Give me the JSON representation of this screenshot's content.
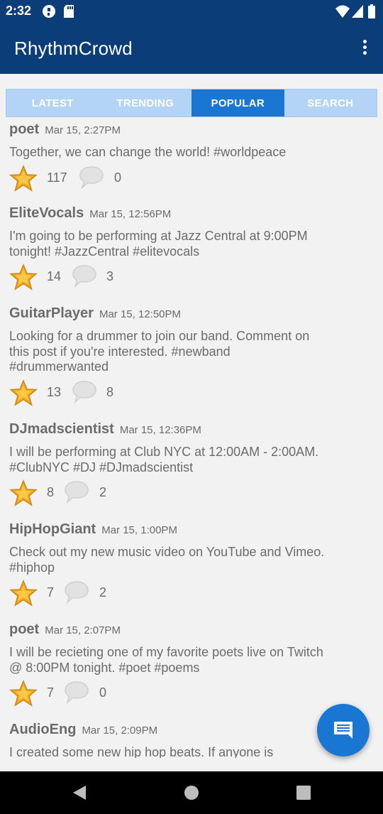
{
  "status_bar": {
    "time": "2:32"
  },
  "app_bar": {
    "title": "RhythmCrowd"
  },
  "tabs": [
    {
      "label": "LATEST",
      "active": false
    },
    {
      "label": "TRENDING",
      "active": false
    },
    {
      "label": "POPULAR",
      "active": true
    },
    {
      "label": "SEARCH",
      "active": false
    }
  ],
  "posts": [
    {
      "user": "poet",
      "date": "Mar 15, 2:27PM",
      "text": "Together, we can change the world! #worldpeace",
      "stars": "117",
      "comments": "0"
    },
    {
      "user": "EliteVocals",
      "date": "Mar 15, 12:56PM",
      "text": "I'm going to be performing at Jazz Central at 9:00PM tonight! #JazzCentral #elitevocals",
      "stars": "14",
      "comments": "3"
    },
    {
      "user": "GuitarPlayer",
      "date": "Mar 15, 12:50PM",
      "text": "Looking for a drummer to join our band. Comment on this post if you're interested. #newband #drummerwanted",
      "stars": "13",
      "comments": "8"
    },
    {
      "user": "DJmadscientist",
      "date": "Mar 15, 12:36PM",
      "text": "I will be performing at Club NYC at 12:00AM - 2:00AM. #ClubNYC #DJ #DJmadscientist",
      "stars": "8",
      "comments": "2"
    },
    {
      "user": "HipHopGiant",
      "date": "Mar 15, 1:00PM",
      "text": "Check out my new music video on YouTube and Vimeo. #hiphop",
      "stars": "7",
      "comments": "2"
    },
    {
      "user": "poet",
      "date": "Mar 15, 2:07PM",
      "text": "I will be recieting one of my favorite poets live on Twitch @ 8:00PM tonight. #poet #poems",
      "stars": "7",
      "comments": "0"
    },
    {
      "user": "AudioEng",
      "date": "Mar 15, 2:09PM",
      "text": "I created some new hip hop beats. If anyone is",
      "stars": "",
      "comments": ""
    }
  ],
  "colors": {
    "primary_dark": "#0b3d79",
    "accent": "#1976d2",
    "tab_inactive": "#b3d4f5",
    "star": "#f5a623"
  },
  "icons": {
    "star": "star-icon",
    "comment": "comment-bubble-icon",
    "fab": "message-icon",
    "menu": "more-vert-icon"
  }
}
